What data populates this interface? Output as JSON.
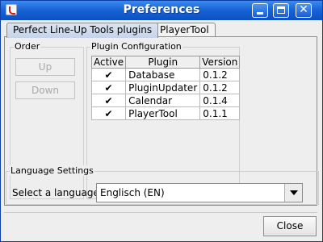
{
  "window": {
    "title": "Preferences",
    "minimize_icon": "minimize-icon",
    "maximize_icon": "maximize-icon",
    "close_glyph": "✕"
  },
  "tabs": [
    {
      "label": "Perfect Line-Up Tools plugins",
      "active": true
    },
    {
      "label": "PlayerTool",
      "active": false
    }
  ],
  "order": {
    "title": "Order",
    "up_label": "Up",
    "down_label": "Down"
  },
  "plugin_config": {
    "title": "Plugin Configuration",
    "columns": [
      "Active",
      "Plugin",
      "Version"
    ],
    "rows": [
      {
        "active": "✔",
        "plugin": "Database",
        "version": "0.1.2"
      },
      {
        "active": "✔",
        "plugin": "PluginUpdater",
        "version": "0.1.2"
      },
      {
        "active": "✔",
        "plugin": "Calendar",
        "version": "0.1.4"
      },
      {
        "active": "✔",
        "plugin": "PlayerTool",
        "version": "0.1.1"
      }
    ]
  },
  "language": {
    "title": "Language Settings",
    "label": "Select a language",
    "selected": "Englisch (EN)"
  },
  "footer": {
    "close_label": "Close"
  }
}
